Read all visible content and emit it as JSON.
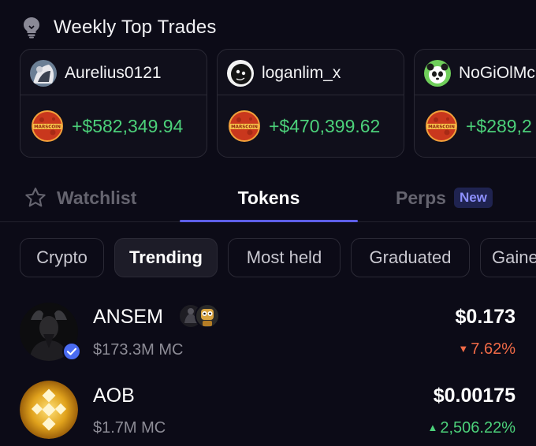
{
  "header": {
    "title": "Weekly Top Trades",
    "icon": "lightbulb-icon"
  },
  "top_trades": [
    {
      "username": "Aurelius0121",
      "profit": "+$582,349.94",
      "coin": "MARSCOIN"
    },
    {
      "username": "loganlim_x",
      "profit": "+$470,399.62",
      "coin": "MARSCOIN"
    },
    {
      "username": "NoGiOlMc",
      "profit": "+$289,2",
      "coin": "MARSCOIN"
    }
  ],
  "tabs": {
    "watchlist": "Watchlist",
    "tokens": "Tokens",
    "perps": "Perps",
    "new_badge": "New"
  },
  "filters": [
    "Crypto",
    "Trending",
    "Most held",
    "Graduated",
    "Gaine"
  ],
  "tokens": [
    {
      "name": "ANSEM",
      "market_cap": "$173.3M MC",
      "price": "$0.173",
      "change": "7.62%",
      "direction": "down"
    },
    {
      "name": "AOB",
      "market_cap": "$1.7M MC",
      "price": "$0.00175",
      "change": "2,506.22%",
      "direction": "up"
    }
  ],
  "colors": {
    "background": "#0c0b17",
    "accent": "#5d5fe8",
    "positive": "#4cd17a",
    "negative": "#f06a47"
  }
}
